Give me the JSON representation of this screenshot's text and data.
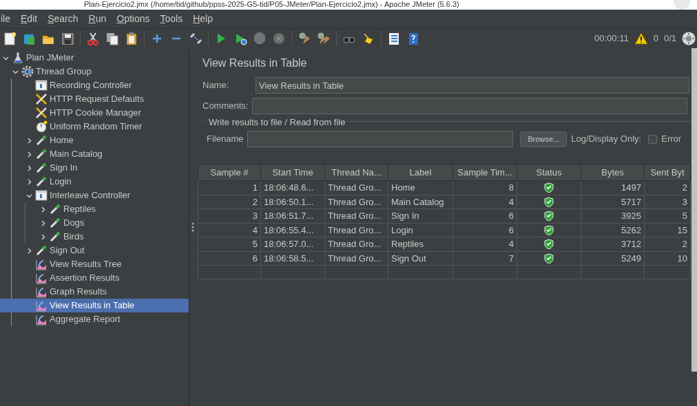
{
  "window": {
    "title": "Plan-Ejercicio2.jmx (/home/tid/github/ppss-2025-G5-tid/P05-JMeter/Plan-Ejercicio2.jmx) - Apache JMeter (5.6.3)"
  },
  "menu": [
    {
      "label": "ile",
      "mnemonic": false
    },
    {
      "label": "Edit",
      "mnemonic": true
    },
    {
      "label": "Search",
      "mnemonic": true
    },
    {
      "label": "Run",
      "mnemonic": true
    },
    {
      "label": "Options",
      "mnemonic": true
    },
    {
      "label": "Tools",
      "mnemonic": true
    },
    {
      "label": "Help",
      "mnemonic": true
    }
  ],
  "toolbar": [
    {
      "kind": "new",
      "disabled": false
    },
    {
      "kind": "templates",
      "disabled": false
    },
    {
      "kind": "open",
      "disabled": false
    },
    {
      "kind": "save",
      "disabled": false
    },
    {
      "kind": "sep"
    },
    {
      "kind": "cut",
      "disabled": false
    },
    {
      "kind": "copy",
      "disabled": false
    },
    {
      "kind": "paste",
      "disabled": false
    },
    {
      "kind": "sep"
    },
    {
      "kind": "expand",
      "disabled": false
    },
    {
      "kind": "collapse",
      "disabled": false
    },
    {
      "kind": "toggle",
      "disabled": false
    },
    {
      "kind": "sep"
    },
    {
      "kind": "start",
      "disabled": false
    },
    {
      "kind": "start_no_timers",
      "disabled": false
    },
    {
      "kind": "stop",
      "disabled": true
    },
    {
      "kind": "shutdown",
      "disabled": true
    },
    {
      "kind": "sep"
    },
    {
      "kind": "clear",
      "disabled": false
    },
    {
      "kind": "clear_all",
      "disabled": false
    },
    {
      "kind": "sep"
    },
    {
      "kind": "search",
      "disabled": false
    },
    {
      "kind": "reset_search",
      "disabled": false
    },
    {
      "kind": "sep"
    },
    {
      "kind": "functions",
      "disabled": false
    },
    {
      "kind": "help",
      "disabled": false
    }
  ],
  "status": {
    "timer": "00:00:11",
    "warnings": "0",
    "threads": "0/1"
  },
  "tree": [
    {
      "label": "Plan JMeter",
      "kind": "plan",
      "expanded": true,
      "selected": false,
      "children": [
        {
          "label": "Thread Group",
          "kind": "threads",
          "expanded": true,
          "selected": false,
          "children": [
            {
              "label": "Recording Controller",
              "kind": "controller",
              "selected": false
            },
            {
              "label": "HTTP Request Defaults",
              "kind": "config",
              "selected": false
            },
            {
              "label": "HTTP Cookie Manager",
              "kind": "config",
              "selected": false
            },
            {
              "label": "Uniform Random Timer",
              "kind": "timer",
              "selected": false
            },
            {
              "label": "Home",
              "kind": "sampler",
              "expanded": false,
              "selected": false
            },
            {
              "label": "Main Catalog",
              "kind": "sampler",
              "expanded": false,
              "selected": false
            },
            {
              "label": "Sign In",
              "kind": "sampler",
              "expanded": false,
              "selected": false
            },
            {
              "label": "Login",
              "kind": "sampler",
              "expanded": false,
              "selected": false
            },
            {
              "label": "Interleave Controller",
              "kind": "controller",
              "expanded": true,
              "selected": false,
              "children": [
                {
                  "label": "Reptiles",
                  "kind": "sampler",
                  "expanded": false,
                  "selected": false
                },
                {
                  "label": "Dogs",
                  "kind": "sampler",
                  "expanded": false,
                  "selected": false
                },
                {
                  "label": "Birds",
                  "kind": "sampler",
                  "expanded": false,
                  "selected": false
                }
              ]
            },
            {
              "label": "Sign Out",
              "kind": "sampler",
              "expanded": false,
              "selected": false
            },
            {
              "label": "View Results Tree",
              "kind": "listener",
              "selected": false
            },
            {
              "label": "Assertion Results",
              "kind": "listener",
              "selected": false
            },
            {
              "label": "Graph Results",
              "kind": "listener",
              "selected": false
            },
            {
              "label": "View Results in Table",
              "kind": "listener",
              "selected": true
            },
            {
              "label": "Aggregate Report",
              "kind": "listener",
              "selected": false
            }
          ]
        }
      ]
    }
  ],
  "panel": {
    "title": "View Results in Table",
    "name_label": "Name:",
    "name_value": "View Results in Table",
    "comments_label": "Comments:",
    "file_group": "Write results to file / Read from file",
    "filename_label": "Filename",
    "browse": "Browse...",
    "log_label": "Log/Display Only:",
    "errors_label": "Error",
    "errors_checked": false
  },
  "table": {
    "columns": [
      "Sample #",
      "Start Time",
      "Thread Na...",
      "Label",
      "Sample Tim...",
      "Status",
      "Bytes",
      "Sent Byt"
    ],
    "rows": [
      {
        "sample": "1",
        "start": "18:06:48.6...",
        "thread": "Thread Gro...",
        "label": "Home",
        "time": "8",
        "success": true,
        "bytes": "1497",
        "sent": "2"
      },
      {
        "sample": "2",
        "start": "18:06:50.1...",
        "thread": "Thread Gro...",
        "label": "Main Catalog",
        "time": "4",
        "success": true,
        "bytes": "5717",
        "sent": "3"
      },
      {
        "sample": "3",
        "start": "18:06:51.7...",
        "thread": "Thread Gro...",
        "label": "Sign In",
        "time": "6",
        "success": true,
        "bytes": "3925",
        "sent": "5"
      },
      {
        "sample": "4",
        "start": "18:06:55.4...",
        "thread": "Thread Gro...",
        "label": "Login",
        "time": "6",
        "success": true,
        "bytes": "5262",
        "sent": "15"
      },
      {
        "sample": "5",
        "start": "18:06:57.0...",
        "thread": "Thread Gro...",
        "label": "Reptiles",
        "time": "4",
        "success": true,
        "bytes": "3712",
        "sent": "2"
      },
      {
        "sample": "6",
        "start": "18:06:58.5...",
        "thread": "Thread Gro...",
        "label": "Sign Out",
        "time": "7",
        "success": true,
        "bytes": "5249",
        "sent": "10"
      }
    ]
  }
}
